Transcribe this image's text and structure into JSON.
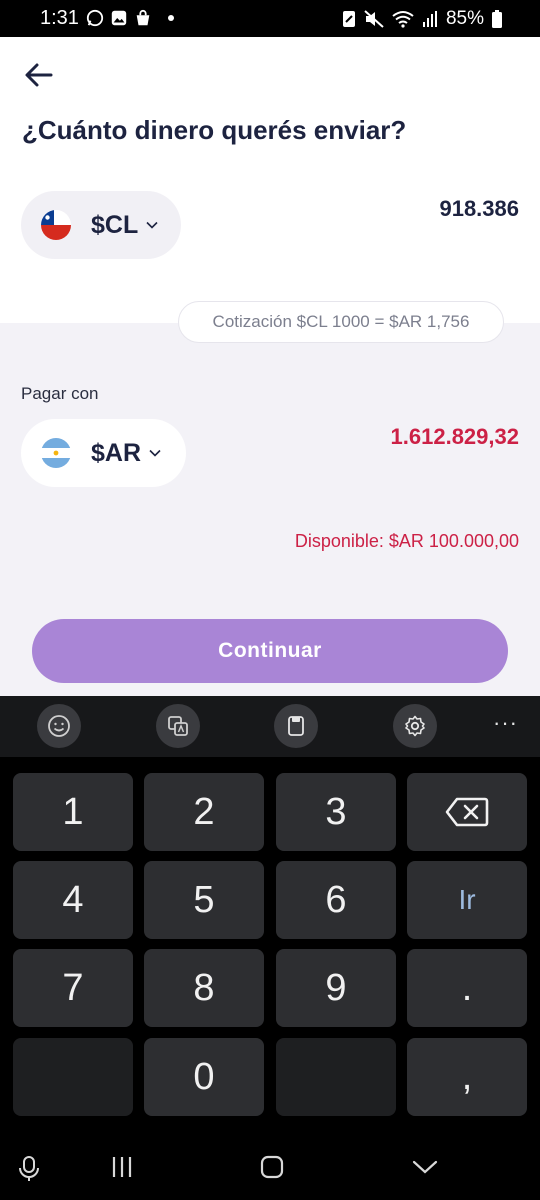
{
  "status_bar": {
    "time": "1:31",
    "battery": "85%",
    "left_icons": [
      "whatsapp-icon",
      "gallery-icon",
      "shopping-bag-icon",
      "notification-dot"
    ],
    "right_icons": [
      "nfc-icon",
      "mute-icon",
      "wifi-icon",
      "signal-icon",
      "battery-icon"
    ]
  },
  "header": {
    "title": "¿Cuánto dinero querés enviar?"
  },
  "send": {
    "currency": "$CL",
    "flag": "chile-flag",
    "amount": "918.386"
  },
  "rate": {
    "text": "Cotización $CL 1000 = $AR 1,756"
  },
  "pay": {
    "label": "Pagar con",
    "currency": "$AR",
    "flag": "argentina-flag",
    "amount": "1.612.829,32",
    "available": "Disponible: $AR 100.000,00"
  },
  "actions": {
    "continue_label": "Continuar"
  },
  "colors": {
    "title": "#1d2340",
    "accent": "#a985d6",
    "negative": "#cc2146",
    "bg_light": "#f3f2f7"
  },
  "keyboard": {
    "toolbar": [
      "emoji-icon",
      "translate-icon",
      "clipboard-icon",
      "settings-icon",
      "more-icon"
    ],
    "keys": {
      "k1": "1",
      "k2": "2",
      "k3": "3",
      "k4": "4",
      "k5": "5",
      "k6": "6",
      "k7": "7",
      "k8": "8",
      "k9": "9",
      "k0": "0",
      "go": "Ir",
      "dot": ".",
      "comma": ","
    }
  },
  "nav": {
    "icons": [
      "mic-icon",
      "recent-apps-icon",
      "home-icon",
      "hide-keyboard-icon"
    ]
  }
}
